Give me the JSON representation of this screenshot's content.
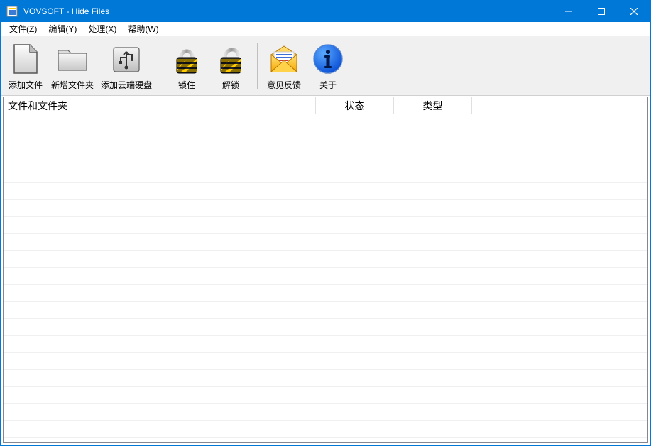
{
  "window": {
    "title": "VOVSOFT - Hide Files"
  },
  "menu": {
    "file": "文件(Z)",
    "edit": "编辑(Y)",
    "process": "处理(X)",
    "help": "帮助(W)"
  },
  "toolbar": {
    "add_file": "添加文件",
    "add_folder": "新增文件夹",
    "add_cloud": "添加云端硬盘",
    "lock": "锁住",
    "unlock": "解锁",
    "feedback": "意见反馈",
    "about": "关于"
  },
  "columns": {
    "files": "文件和文件夹",
    "status": "状态",
    "type": "类型"
  },
  "rows": []
}
